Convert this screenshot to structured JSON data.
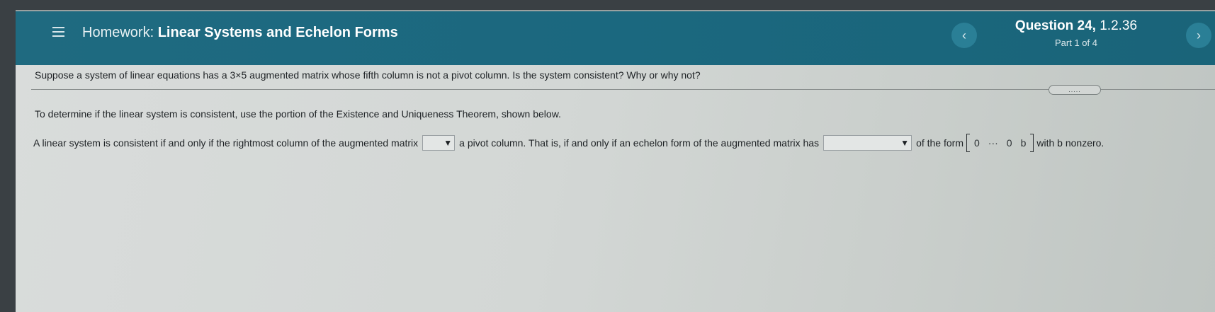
{
  "header": {
    "menu_icon": "hamburger-menu-icon",
    "homework_prefix": "Homework: ",
    "homework_title": "Linear Systems and Echelon Forms",
    "prev_label": "‹",
    "next_label": "›",
    "question_label": "Question 24,",
    "question_id": " 1.2.36",
    "part": "Part 1 of 4"
  },
  "question_text": "Suppose a system of linear equations has a 3×5 augmented matrix whose fifth column is not a pivot column. Is the system consistent? Why or why not?",
  "more_button": ".....",
  "intro_text": "To determine if the linear system is consistent, use the portion of the Existence and Uniqueness Theorem, shown below.",
  "answer": {
    "part1": "A linear system is consistent if and only if the rightmost column of the augmented matrix",
    "dropdown1_value": "",
    "part2": "a pivot column. That is, if and only if an echelon form of the augmented matrix has",
    "dropdown2_value": "",
    "part3": "of the form",
    "matrix_cells": [
      "0",
      "···",
      "0",
      "b"
    ],
    "part4": "with b nonzero."
  },
  "colors": {
    "header_bg": "#1d6880",
    "page_bg": "#d5d9d7"
  }
}
